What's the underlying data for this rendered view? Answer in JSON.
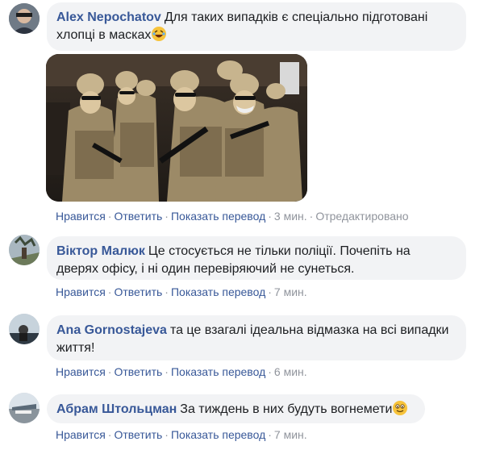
{
  "comments": [
    {
      "author": "Alex Nepochatov",
      "text_line1": "Для таких випадків є спеціально підготовані",
      "text_line2": "хлопці в масках",
      "emoji": "laughing-emoji",
      "has_photo": true,
      "actions": {
        "like": "Нравится",
        "reply": "Ответить",
        "translate": "Показать перевод",
        "time": "3 мин.",
        "edited": "Отредактировано"
      }
    },
    {
      "author": "Віктор Малюк",
      "text_line1": "Це стосується не тільки поліції. Почепіть на",
      "text_line2": "дверях офісу, і ні один перевіряючий не сунеться.",
      "actions": {
        "like": "Нравится",
        "reply": "Ответить",
        "translate": "Показать перевод",
        "time": "7 мин."
      }
    },
    {
      "author": "Ana Gornostajeva",
      "text_line1": "та це взагалі ідеальна відмазка на всі випадки",
      "text_line2": "життя!",
      "actions": {
        "like": "Нравится",
        "reply": "Ответить",
        "translate": "Показать перевод",
        "time": "6 мин."
      }
    },
    {
      "author": "Абрам Штольцман",
      "text_line1": "За тиждень в них будуть вогнемети",
      "emoji": "smiling-emoji",
      "actions": {
        "like": "Нравится",
        "reply": "Ответить",
        "translate": "Показать перевод",
        "time": "7 мин."
      }
    }
  ],
  "colors": {
    "link": "#385898",
    "bubble": "#f2f3f5",
    "meta": "#90949c",
    "text": "#1c1e21"
  }
}
